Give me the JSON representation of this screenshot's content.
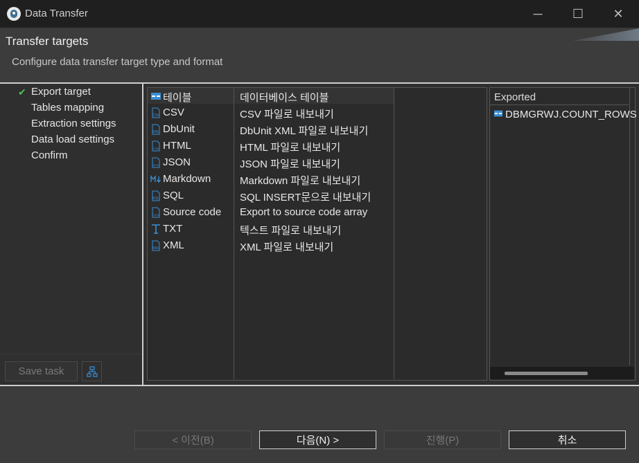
{
  "window": {
    "title": "Data Transfer",
    "controls": {
      "minimize": "─",
      "maximize": "☐",
      "close": "✕"
    }
  },
  "header": {
    "title": "Transfer targets",
    "subtitle": "Configure data transfer target type and format"
  },
  "nav": {
    "items": [
      {
        "label": "Export target",
        "checked": true
      },
      {
        "label": "Tables mapping"
      },
      {
        "label": "Extraction settings"
      },
      {
        "label": "Data load settings"
      },
      {
        "label": "Confirm"
      }
    ],
    "save_task": "Save task"
  },
  "formats": [
    {
      "icon": "table-icon",
      "name": "테이블",
      "desc": "데이터베이스 테이블"
    },
    {
      "icon": "csv-file-icon",
      "name": "CSV",
      "desc": "CSV 파일로 내보내기"
    },
    {
      "icon": "xml-file-icon",
      "name": "DbUnit",
      "desc": "DbUnit XML 파일로 내보내기"
    },
    {
      "icon": "html-file-icon",
      "name": "HTML",
      "desc": "HTML 파일로 내보내기"
    },
    {
      "icon": "json-file-icon",
      "name": "JSON",
      "desc": "JSON 파일로 내보내기"
    },
    {
      "icon": "markdown-icon",
      "name": "Markdown",
      "desc": "Markdown 파일로 내보내기"
    },
    {
      "icon": "sql-file-icon",
      "name": "SQL",
      "desc": "SQL INSERT문으로 내보내기"
    },
    {
      "icon": "code-file-icon",
      "name": "Source code",
      "desc": "Export to source code array"
    },
    {
      "icon": "text-icon",
      "name": "TXT",
      "desc": "텍스트 파일로 내보내기"
    },
    {
      "icon": "xml-file-icon",
      "name": "XML",
      "desc": "XML 파일로 내보내기"
    }
  ],
  "exported": {
    "header": "Exported",
    "items": [
      "DBMGRWJ.COUNT_ROWS"
    ]
  },
  "buttons": {
    "back": "< 이전(B)",
    "next": "다음(N) >",
    "proceed": "진행(P)",
    "cancel": "취소"
  },
  "colors": {
    "accent_check": "#4fbf4f",
    "table_icon": "#3a8fd6"
  }
}
